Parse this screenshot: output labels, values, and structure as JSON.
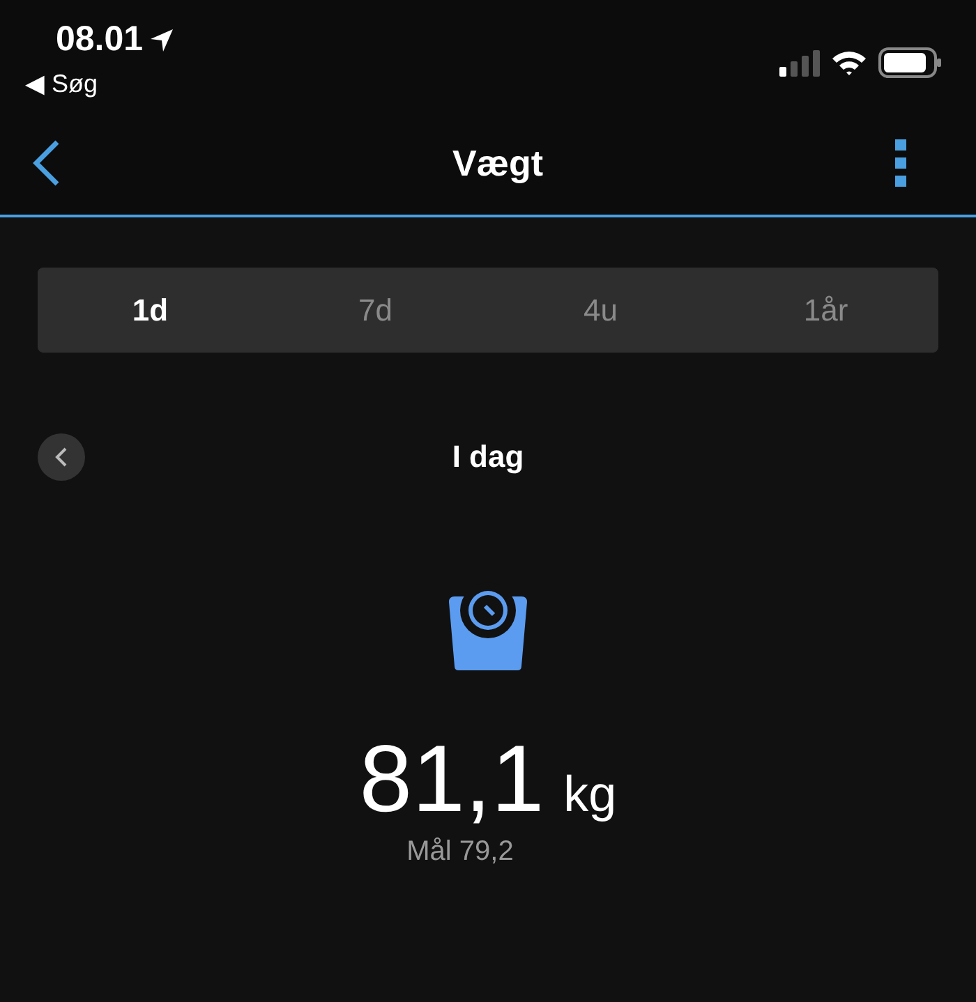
{
  "status_bar": {
    "time": "08.01",
    "back_label": "◀ Søg"
  },
  "nav": {
    "title": "Vægt"
  },
  "tabs": [
    {
      "label": "1d",
      "selected": true
    },
    {
      "label": "7d",
      "selected": false
    },
    {
      "label": "4u",
      "selected": false
    },
    {
      "label": "1år",
      "selected": false
    }
  ],
  "period": {
    "label": "I dag"
  },
  "weight": {
    "value": "81,1",
    "unit": "kg",
    "goal": "Mål 79,2"
  }
}
